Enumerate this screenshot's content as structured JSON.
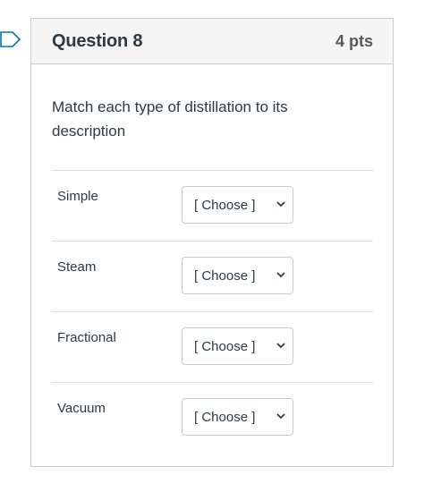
{
  "question": {
    "title": "Question 8",
    "points": "4 pts",
    "prompt": "Match each type of distillation to its description",
    "rows": [
      {
        "label": "Simple",
        "select_value": "[ Choose ]"
      },
      {
        "label": "Steam",
        "select_value": "[ Choose ]"
      },
      {
        "label": "Fractional",
        "select_value": "[ Choose ]"
      },
      {
        "label": "Vacuum",
        "select_value": "[ Choose ]"
      }
    ]
  },
  "colors": {
    "flag_outline": "#0374B5",
    "header_bg": "#f5f5f5",
    "border": "#c7cdd1"
  },
  "icons": {
    "flag": "bookmark-flag-icon",
    "dropdown": "chevron-down-icon"
  }
}
